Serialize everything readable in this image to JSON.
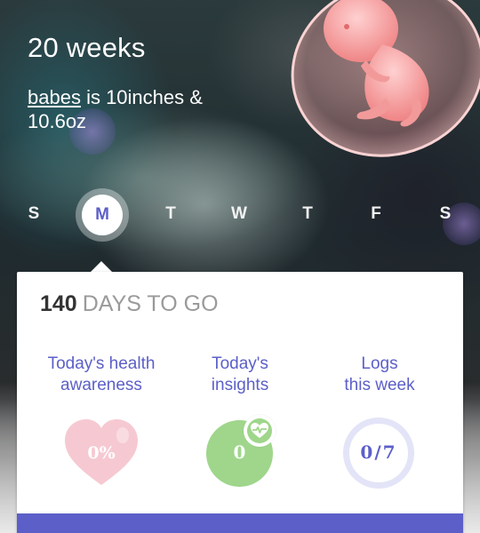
{
  "header": {
    "week_title": "20 weeks",
    "baby_name": "babes",
    "size_text": " is 10inches & 10.6oz"
  },
  "week_days": [
    {
      "letter": "S",
      "selected": false
    },
    {
      "letter": "M",
      "selected": true
    },
    {
      "letter": "T",
      "selected": false
    },
    {
      "letter": "W",
      "selected": false
    },
    {
      "letter": "T",
      "selected": false
    },
    {
      "letter": "F",
      "selected": false
    },
    {
      "letter": "S",
      "selected": false
    }
  ],
  "card": {
    "days_left": "140",
    "days_label": "DAYS TO GO",
    "health": {
      "line1": "Today's health",
      "line2": "awareness",
      "value": "0%",
      "icon": "heart-icon"
    },
    "insights": {
      "line1": "Today's",
      "line2": "insights",
      "value": "0",
      "icon": "heart-pulse-icon"
    },
    "logs": {
      "line1": "Logs",
      "line2": "this week",
      "value": "0/7",
      "logged": 0,
      "total": 7
    }
  },
  "colors": {
    "accent": "#5c5fc8",
    "heart": "#f6c9d2",
    "insight_green": "#9fd68b",
    "ring": "#e3e4f7",
    "fetus": "#f08a8a"
  }
}
